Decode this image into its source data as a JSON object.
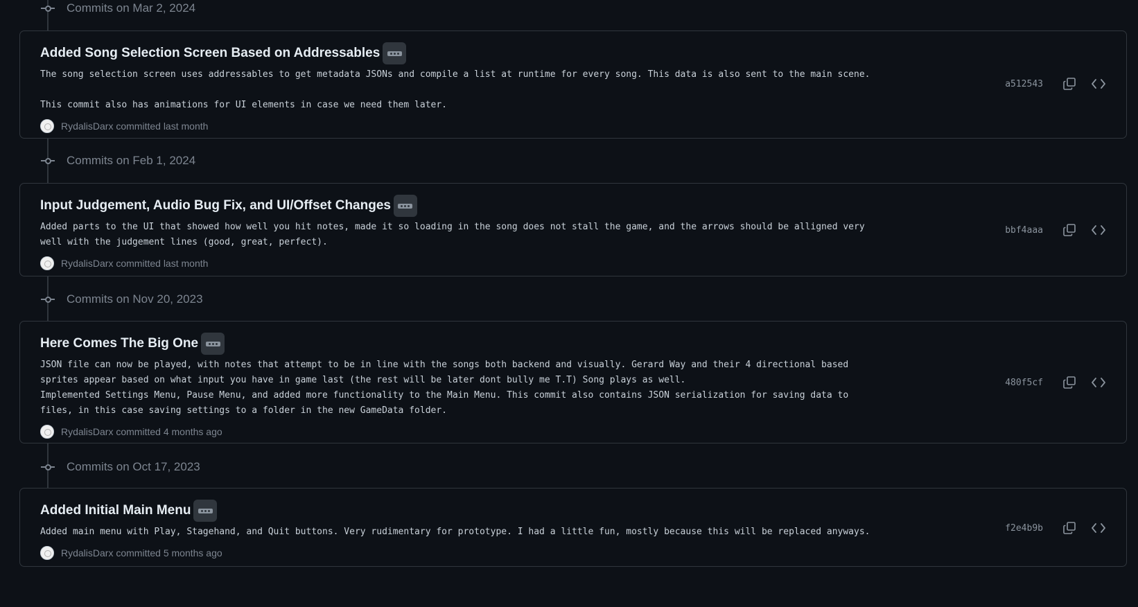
{
  "groups": [
    {
      "date_label": "Commits on Mar 2, 2024",
      "commits": [
        {
          "title": "Added Song Selection Screen Based on Addressables",
          "description": "The song selection screen uses addressables to get metadata JSONs and compile a list at runtime for every song. This data is also sent to the main scene.\n\nThis commit also has animations for UI elements in case we need them later.",
          "author": "RydalisDarx",
          "author_suffix": "committed last month",
          "sha": "a512543"
        }
      ]
    },
    {
      "date_label": "Commits on Feb 1, 2024",
      "commits": [
        {
          "title": "Input Judgement, Audio Bug Fix, and UI/Offset Changes",
          "description": "Added parts to the UI that showed how well you hit notes, made it so loading in the song does not stall the game, and the arrows should be alligned very\nwell with the judgement lines (good, great, perfect).",
          "author": "RydalisDarx",
          "author_suffix": "committed last month",
          "sha": "bbf4aaa"
        }
      ]
    },
    {
      "date_label": "Commits on Nov 20, 2023",
      "commits": [
        {
          "title": "Here Comes The Big One",
          "description": "JSON file can now be played, with notes that attempt to be in line with the songs both backend and visually. Gerard Way and their 4 directional based\nsprites appear based on what input you have in game last (the rest will be later dont bully me T.T) Song plays as well.\nImplemented Settings Menu, Pause Menu, and added more functionality to the Main Menu. This commit also contains JSON serialization for saving data to\nfiles, in this case saving settings to a folder in the new GameData folder.",
          "author": "RydalisDarx",
          "author_suffix": "committed 4 months ago",
          "sha": "480f5cf"
        }
      ]
    },
    {
      "date_label": "Commits on Oct 17, 2023",
      "commits": [
        {
          "title": "Added Initial Main Menu",
          "description": "Added main menu with Play, Stagehand, and Quit buttons. Very rudimentary for prototype. I had a little fun, mostly because this will be replaced anyways.",
          "author": "RydalisDarx",
          "author_suffix": "committed 5 months ago",
          "sha": "f2e4b9b"
        }
      ]
    }
  ],
  "icons": {
    "ellipsis": "kebab-horizontal-icon",
    "copy": "copy-icon",
    "browse": "code-icon",
    "timeline": "git-commit-icon"
  },
  "colors": {
    "background": "#0d1117",
    "border": "#30363d",
    "muted": "#7d8590",
    "text": "#e6edf3"
  }
}
